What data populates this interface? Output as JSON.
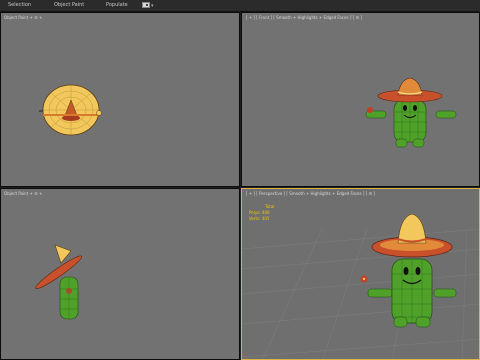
{
  "tabs": [
    {
      "label": "Selection"
    },
    {
      "label": "Object Paint"
    },
    {
      "label": "Populate"
    }
  ],
  "viewports": {
    "top": {
      "label": "Object Paint + ☰ +"
    },
    "front": {
      "label": "[ + ] [ Front ] [ Smooth + Highlights + Edged Faces ] [ ☰ ]"
    },
    "left": {
      "label": "Object Paint + ☰ +"
    },
    "persp": {
      "label": "[ + ] [ Perspective ] [ Smooth + Highlights + Edged Faces ] [ ☰ ]"
    }
  },
  "stats": {
    "header": "Total",
    "polys_label": "Polys:",
    "polys_value": "406",
    "verts_label": "Verts:",
    "verts_value": "405"
  },
  "colors": {
    "viewport_bg": "#727272",
    "active_border": "#d8b640",
    "cactus_green": "#4fa12a",
    "hat_yellow": "#f0c86a",
    "hat_brim_red": "#c2452a",
    "stats_text": "#f0c800"
  }
}
